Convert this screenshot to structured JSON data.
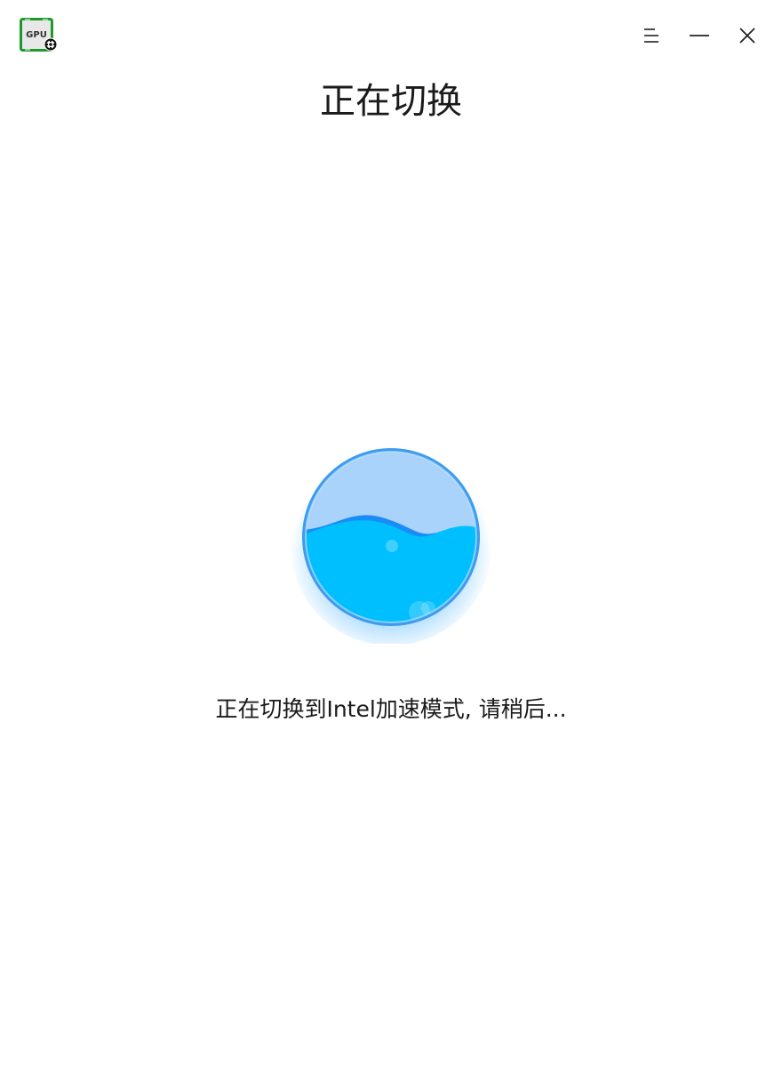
{
  "window": {
    "app_icon": {
      "name": "gpu-settings-icon",
      "label": "GPU"
    },
    "controls": {
      "menu_icon": "menu-icon",
      "minimize_icon": "minimize-icon",
      "close_icon": "close-icon"
    }
  },
  "main": {
    "title": "正在切换",
    "status_message": "正在切换到Intel加速模式, 请稍后...",
    "progress_icon": "water-progress-orb",
    "progress_level": 0.5
  },
  "colors": {
    "app_icon_border": "#1e9a2c",
    "orb_ring": "#3b9cf0",
    "orb_top": "#a9d3fb",
    "water_front": "#00bfff",
    "water_back": "#1a8cf5",
    "text": "#1a1a1a"
  }
}
